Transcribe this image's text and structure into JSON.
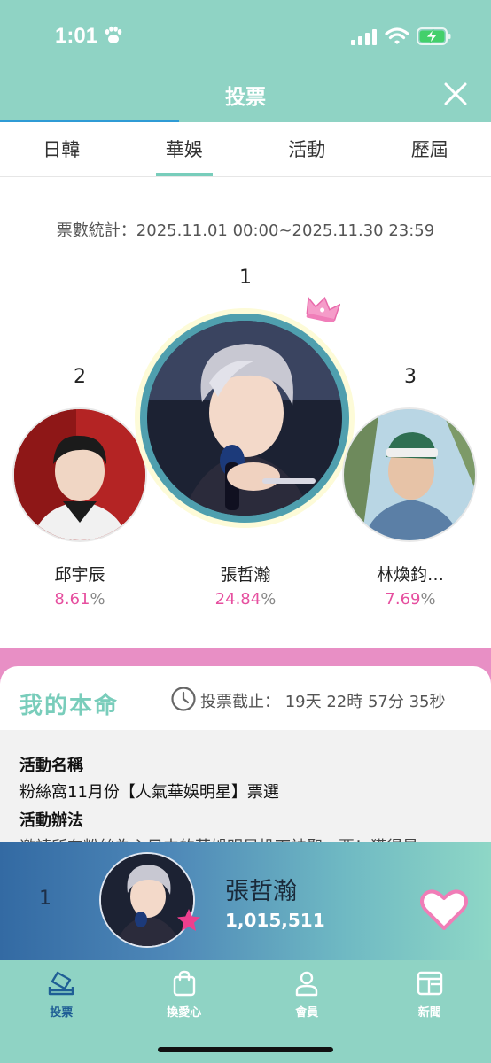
{
  "status_bar": {
    "time": "1:01",
    "paw_icon": "paw-icon",
    "signal_icon": "cellular-signal-icon",
    "wifi_icon": "wifi-icon",
    "battery_icon": "battery-charging-icon"
  },
  "header": {
    "title": "投票",
    "close_icon": "close-icon"
  },
  "tabs": [
    {
      "label": "日韓",
      "active": false
    },
    {
      "label": "華娛",
      "active": true
    },
    {
      "label": "活動",
      "active": false
    },
    {
      "label": "歷屆",
      "active": false
    }
  ],
  "stats_period": "票數統計：2025.11.01 00:00~2025.11.30 23:59",
  "podium": [
    {
      "rank": "1",
      "name": "張哲瀚",
      "percent_value": "24.84",
      "percent_sign": "%",
      "crown_icon": "crown-icon"
    },
    {
      "rank": "2",
      "name": "邱宇辰",
      "percent_value": "8.61",
      "percent_sign": "%"
    },
    {
      "rank": "3",
      "name": "林煥鈞…",
      "percent_value": "7.69",
      "percent_sign": "%"
    }
  ],
  "my_section": {
    "title": "我的本命",
    "clock_icon": "clock-icon",
    "deadline": "投票截止： 19天 22時 57分 35秒"
  },
  "activity": {
    "name_label": "活動名稱",
    "name_value": "粉絲窩11月份【人氣華娛明星】票選",
    "method_label": "活動辦法",
    "method_value": "邀請所有粉絲為心目中的華娛明星投下神聖一票！獲得最"
  },
  "my_vote": {
    "rank": "1",
    "name": "張哲瀚",
    "votes": "1,015,511",
    "star_icon": "star-icon",
    "heart_icon": "heart-icon"
  },
  "bottom_nav": [
    {
      "label": "投票",
      "icon": "vote-icon",
      "active": true
    },
    {
      "label": "換愛心",
      "icon": "shopping-bag-icon",
      "active": false
    },
    {
      "label": "會員",
      "icon": "person-icon",
      "active": false
    },
    {
      "label": "新聞",
      "icon": "news-icon",
      "active": false
    }
  ],
  "colors": {
    "header_bg": "#8fd3c4",
    "accent_teal": "#79cdbb",
    "pink": "#e64f9f",
    "banner_dark": "#336aa3"
  }
}
